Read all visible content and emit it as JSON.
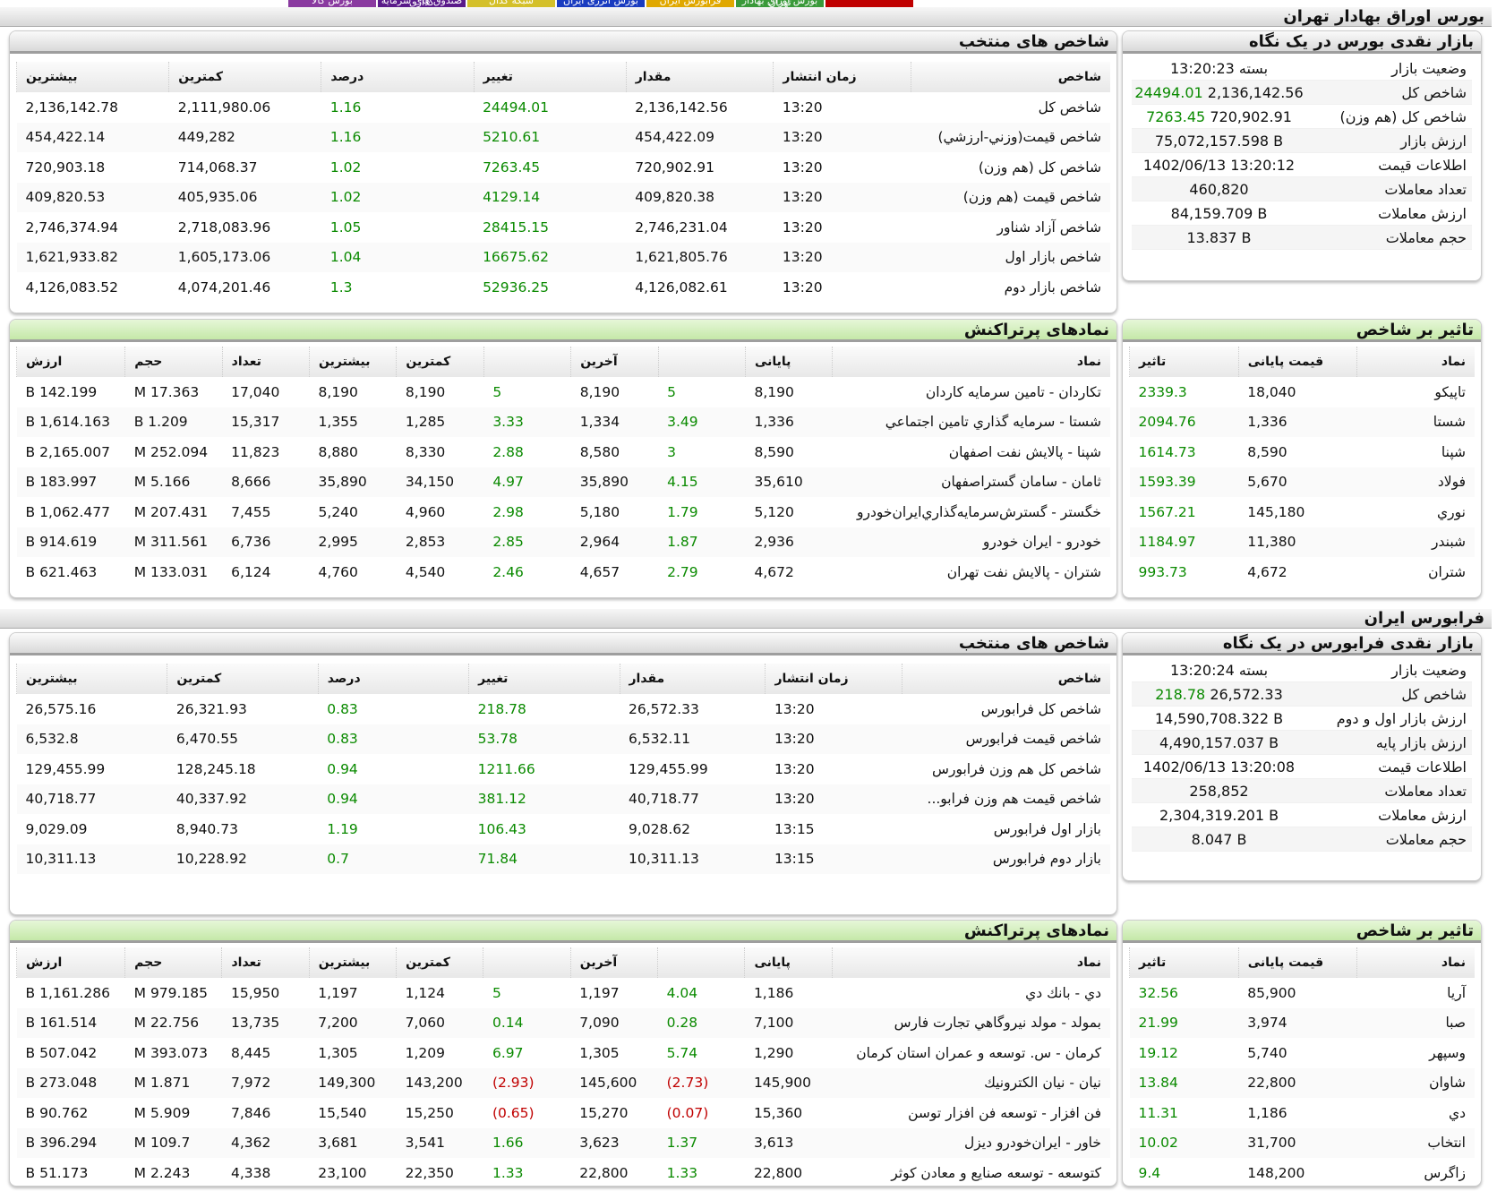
{
  "top_tabs": [
    "",
    "بورس اوراق بهادار تهران",
    "فرابورس ایران",
    "بورس انرژی ایران",
    "شبکه کدال",
    "صندوق های سرمایه گذاری",
    "بورس کالا"
  ],
  "tab_colors": [
    "#c00000",
    "#3a9a3a",
    "#e0a800",
    "#1a3cc0",
    "#d4c02a",
    "#5a1a8a",
    "#8a3aa0"
  ],
  "tse": {
    "section_title": "بورس اوراق بهادار تهران",
    "summary": {
      "title": "بازار نقدی بورس در یک نگاه",
      "rows": [
        {
          "label": "وضعیت بازار",
          "value": "بسته 13:20:23"
        },
        {
          "label": "شاخص کل",
          "value": "2,136,142.56",
          "change": "24494.01"
        },
        {
          "label": "شاخص کل (هم وزن)",
          "value": "720,902.91",
          "change": "7263.45"
        },
        {
          "label": "ارزش بازار",
          "value": "75,072,157.598 B"
        },
        {
          "label": "اطلاعات قیمت",
          "value": "1402/06/13 13:20:12"
        },
        {
          "label": "تعداد معاملات",
          "value": "460,820"
        },
        {
          "label": "ارزش معاملات",
          "value": "84,159.709 B"
        },
        {
          "label": "حجم معاملات",
          "value": "13.837 B"
        }
      ]
    },
    "indices": {
      "title": "شاخص های منتخب",
      "headers": [
        "شاخص",
        "زمان انتشار",
        "مقدار",
        "تغییر",
        "درصد",
        "کمترین",
        "بیشترین"
      ],
      "rows": [
        [
          "شاخص كل",
          "13:20",
          "2,136,142.56",
          "24494.01",
          "1.16",
          "2,111,980.06",
          "2,136,142.78"
        ],
        [
          "شاخص قيمت(وزني-ارزشي)",
          "13:20",
          "454,422.09",
          "5210.61",
          "1.16",
          "449,282",
          "454,422.14"
        ],
        [
          "شاخص كل (هم وزن)",
          "13:20",
          "720,902.91",
          "7263.45",
          "1.02",
          "714,068.37",
          "720,903.18"
        ],
        [
          "شاخص قيمت (هم وزن)",
          "13:20",
          "409,820.38",
          "4129.14",
          "1.02",
          "405,935.06",
          "409,820.53"
        ],
        [
          "شاخص آزاد شناور",
          "13:20",
          "2,746,231.04",
          "28415.15",
          "1.05",
          "2,718,083.96",
          "2,746,374.94"
        ],
        [
          "شاخص بازار اول",
          "13:20",
          "1,621,805.76",
          "16675.62",
          "1.04",
          "1,605,173.06",
          "1,621,933.82"
        ],
        [
          "شاخص بازار دوم",
          "13:20",
          "4,126,082.61",
          "52936.25",
          "1.3",
          "4,074,201.46",
          "4,126,083.52"
        ]
      ]
    },
    "impact": {
      "title": "تاثیر بر شاخص",
      "headers": [
        "نماد",
        "قیمت پایانی",
        "تاثیر"
      ],
      "rows": [
        [
          "تاپيكو",
          "18,040",
          "2339.3"
        ],
        [
          "شستا",
          "1,336",
          "2094.76"
        ],
        [
          "شپنا",
          "8,590",
          "1614.73"
        ],
        [
          "فولاد",
          "5,670",
          "1593.39"
        ],
        [
          "نوري",
          "145,180",
          "1567.21"
        ],
        [
          "شبندر",
          "11,380",
          "1184.97"
        ],
        [
          "شتران",
          "4,672",
          "993.73"
        ]
      ]
    },
    "trades": {
      "title": "نمادهای پرتراکنش",
      "headers": [
        "نماد",
        "پایانی",
        "",
        "آخرین",
        "",
        "کمترین",
        "بیشترین",
        "تعداد",
        "حجم",
        "ارزش"
      ],
      "rows": [
        [
          "تكاردان - تامين سرمايه كاردان",
          "8,190",
          "5",
          "8,190",
          "5",
          "8,190",
          "8,190",
          "17,040",
          "17.363 M",
          "142.199 B"
        ],
        [
          "شستا - سرمايه گذاري تامين اجتماعي",
          "1,336",
          "3.49",
          "1,334",
          "3.33",
          "1,285",
          "1,355",
          "15,317",
          "1.209 B",
          "1,614.163 B"
        ],
        [
          "شپنا - پالايش نفت اصفهان",
          "8,590",
          "3",
          "8,580",
          "2.88",
          "8,330",
          "8,880",
          "11,823",
          "252.094 M",
          "2,165.007 B"
        ],
        [
          "ثامان - سامان گستراصفهان",
          "35,610",
          "4.15",
          "35,890",
          "4.97",
          "34,150",
          "35,890",
          "8,666",
          "5.166 M",
          "183.997 B"
        ],
        [
          "خگستر - گسترش‌سرمايه‌گذاري‌ايران‌خودرو",
          "5,120",
          "1.79",
          "5,180",
          "2.98",
          "4,960",
          "5,240",
          "7,455",
          "207.431 M",
          "1,062.477 B"
        ],
        [
          "خودرو - ايران‌ خودرو",
          "2,936",
          "1.87",
          "2,964",
          "2.85",
          "2,853",
          "2,995",
          "6,736",
          "311.561 M",
          "914.619 B"
        ],
        [
          "شتران - پالايش نفت تهران",
          "4,672",
          "2.79",
          "4,657",
          "2.46",
          "4,540",
          "4,760",
          "6,124",
          "133.031 M",
          "621.463 B"
        ]
      ]
    }
  },
  "ifb": {
    "section_title": "فرابورس ایران",
    "summary": {
      "title": "بازار نقدی فرابورس در یک نگاه",
      "rows": [
        {
          "label": "وضعیت بازار",
          "value": "بسته 13:20:24"
        },
        {
          "label": "شاخص کل",
          "value": "26,572.33",
          "change": "218.78"
        },
        {
          "label": "ارزش بازار اول و دوم",
          "value": "14,590,708.322 B"
        },
        {
          "label": "ارزش بازار پایه",
          "value": "4,490,157.037 B"
        },
        {
          "label": "اطلاعات قیمت",
          "value": "1402/06/13 13:20:08"
        },
        {
          "label": "تعداد معاملات",
          "value": "258,852"
        },
        {
          "label": "ارزش معاملات",
          "value": "2,304,319.201 B"
        },
        {
          "label": "حجم معاملات",
          "value": "8.047 B"
        }
      ]
    },
    "indices": {
      "title": "شاخص های منتخب",
      "headers": [
        "شاخص",
        "زمان انتشار",
        "مقدار",
        "تغییر",
        "درصد",
        "کمترین",
        "بیشترین"
      ],
      "rows": [
        [
          "شاخص كل فرابورس",
          "13:20",
          "26,572.33",
          "218.78",
          "0.83",
          "26,321.93",
          "26,575.16"
        ],
        [
          "شاخص قيمت فرابورس",
          "13:20",
          "6,532.11",
          "53.78",
          "0.83",
          "6,470.55",
          "6,532.8"
        ],
        [
          "شاخص كل هم وزن فرابورس",
          "13:20",
          "129,455.99",
          "1211.66",
          "0.94",
          "128,245.18",
          "129,455.99"
        ],
        [
          "شاخص قيمت هم وزن فرابو...",
          "13:20",
          "40,718.77",
          "381.12",
          "0.94",
          "40,337.92",
          "40,718.77"
        ],
        [
          "بازار اول فرابورس",
          "13:15",
          "9,028.62",
          "106.43",
          "1.19",
          "8,940.73",
          "9,029.09"
        ],
        [
          "بازار دوم فرابورس",
          "13:15",
          "10,311.13",
          "71.84",
          "0.7",
          "10,228.92",
          "10,311.13"
        ]
      ]
    },
    "impact": {
      "title": "تاثیر بر شاخص",
      "headers": [
        "نماد",
        "قیمت پایانی",
        "تاثیر"
      ],
      "rows": [
        [
          "آريا",
          "85,900",
          "32.56"
        ],
        [
          "صبا",
          "3,974",
          "21.99"
        ],
        [
          "وسپهر",
          "5,740",
          "19.12"
        ],
        [
          "شاوان",
          "22,800",
          "13.84"
        ],
        [
          "دي",
          "1,186",
          "11.31"
        ],
        [
          "انتخاب",
          "31,700",
          "10.02"
        ],
        [
          "زاگرس",
          "148,200",
          "9.4"
        ]
      ]
    },
    "trades": {
      "title": "نمادهای پرتراکنش",
      "headers": [
        "نماد",
        "پایانی",
        "",
        "آخرین",
        "",
        "کمترین",
        "بیشترین",
        "تعداد",
        "حجم",
        "ارزش"
      ],
      "rows": [
        [
          "دي - بانك دي",
          "1,186",
          "4.04",
          "1,197",
          "5",
          "1,124",
          "1,197",
          "15,950",
          "979.185 M",
          "1,161.286 B"
        ],
        [
          "بمولد - مولد نيروگاهي تجارت فارس",
          "7,100",
          "0.28",
          "7,090",
          "0.14",
          "7,060",
          "7,200",
          "13,735",
          "22.756 M",
          "161.514 B"
        ],
        [
          "كرمان - س. توسعه و عمران استان كرمان",
          "1,290",
          "5.74",
          "1,305",
          "6.97",
          "1,209",
          "1,305",
          "8,445",
          "393.073 M",
          "507.042 B"
        ],
        [
          "نيان - نيان الكترونيك",
          "145,900",
          "(2.73)",
          "145,600",
          "(2.93)",
          "143,200",
          "149,300",
          "7,972",
          "1.871 M",
          "273.048 B"
        ],
        [
          "فن افزار - توسعه فن افزار توسن",
          "15,360",
          "(0.07)",
          "15,270",
          "(0.65)",
          "15,250",
          "15,540",
          "7,846",
          "5.909 M",
          "90.762 B"
        ],
        [
          "خاور - ايران‌خودرو ديزل",
          "3,613",
          "1.37",
          "3,623",
          "1.66",
          "3,541",
          "3,681",
          "4,362",
          "109.7 M",
          "396.294 B"
        ],
        [
          "كتوسعه - توسعه صنايع و معادن كوثر",
          "22,800",
          "1.33",
          "22,800",
          "1.33",
          "22,350",
          "23,100",
          "4,338",
          "2.243 M",
          "51.173 B"
        ]
      ]
    }
  }
}
